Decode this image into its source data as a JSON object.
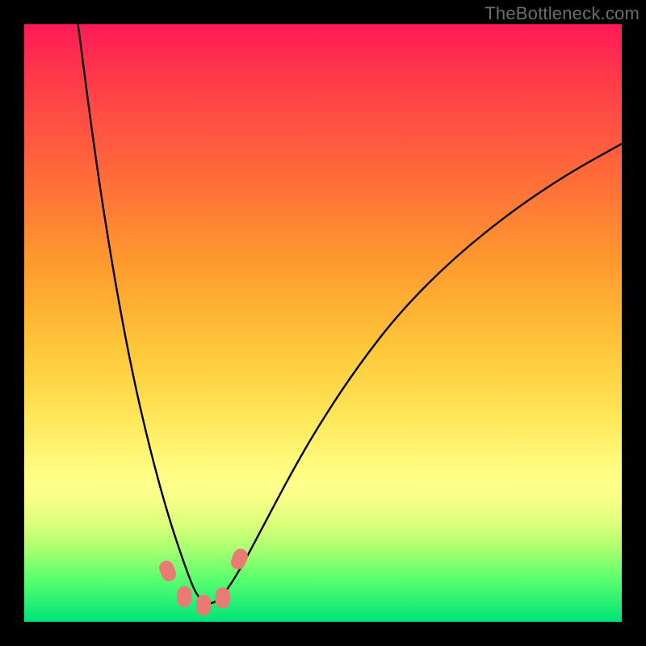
{
  "watermark": "TheBottleneck.com",
  "chart_data": {
    "type": "line",
    "title": "",
    "xlabel": "",
    "ylabel": "",
    "xlim": [
      0,
      1
    ],
    "ylim": [
      0,
      1
    ],
    "grid": false,
    "legend": false,
    "notes": "Axes are unlabeled; values are normalized plot coordinates (0–1 on each axis). The background encodes a vertical gradient from high bottleneck (red, top, y≈1) to none (green, bottom, y≈0). The black curve is a V-shaped bottleneck profile with its minimum near x≈0.30, y≈0.03, rising steeply to y≈1 at x≈0.09 on the left and climbing to y≈0.80 at x≈1 on the right. Five pink-red marker dots sit near the trough.",
    "series": [
      {
        "name": "bottleneck-curve",
        "x": [
          0.09,
          0.12,
          0.15,
          0.18,
          0.21,
          0.24,
          0.27,
          0.29,
          0.31,
          0.33,
          0.36,
          0.4,
          0.45,
          0.5,
          0.56,
          0.63,
          0.72,
          0.82,
          0.91,
          1.0
        ],
        "y": [
          1.0,
          0.77,
          0.58,
          0.42,
          0.29,
          0.18,
          0.09,
          0.04,
          0.028,
          0.04,
          0.085,
          0.16,
          0.255,
          0.34,
          0.43,
          0.52,
          0.61,
          0.69,
          0.75,
          0.8
        ]
      }
    ],
    "markers": [
      {
        "x": 0.24,
        "y": 0.085
      },
      {
        "x": 0.268,
        "y": 0.042
      },
      {
        "x": 0.3,
        "y": 0.028
      },
      {
        "x": 0.332,
        "y": 0.04
      },
      {
        "x": 0.36,
        "y": 0.105
      }
    ],
    "gradient_stops": [
      {
        "y": 1.0,
        "color": "#ff1a55"
      },
      {
        "y": 0.45,
        "color": "#ffc93a"
      },
      {
        "y": 0.23,
        "color": "#feff8a"
      },
      {
        "y": 0.0,
        "color": "#00e37a"
      }
    ]
  }
}
